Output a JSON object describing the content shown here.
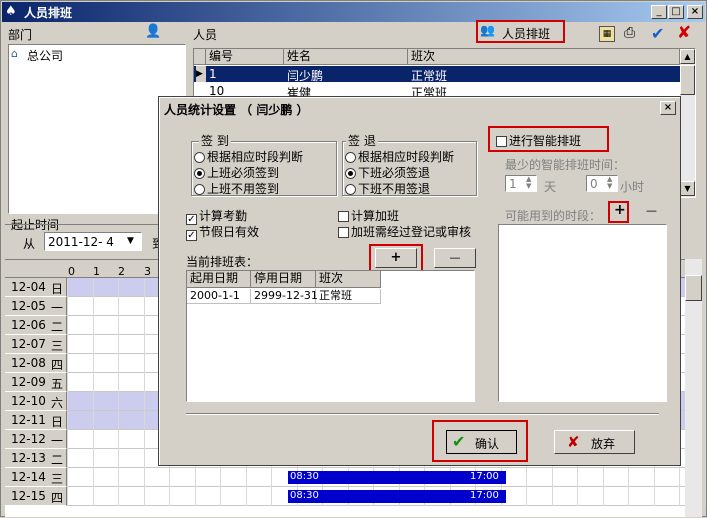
{
  "main_window": {
    "title": "人员排班",
    "dept_label": "部门",
    "person_label": "人员",
    "schedule_button": "人员排班",
    "tree_root": "总公司",
    "person_table": {
      "headers": [
        "编号",
        "姓名",
        "班次"
      ],
      "rows": [
        {
          "id": "1",
          "name": "闫少鹏",
          "shift": "正常班",
          "selected": true
        },
        {
          "id": "10",
          "name": "崔健",
          "shift": "正常班",
          "selected": false
        }
      ]
    },
    "period_label": "起止时间",
    "from_label": "从",
    "from_date": "2011-12- 4",
    "to_partial": "到",
    "hours": [
      "0",
      "1",
      "2",
      "3"
    ],
    "dates": [
      {
        "date": "12-04",
        "day": "日"
      },
      {
        "date": "12-05",
        "day": "一"
      },
      {
        "date": "12-06",
        "day": "二"
      },
      {
        "date": "12-07",
        "day": "三"
      },
      {
        "date": "12-08",
        "day": "四"
      },
      {
        "date": "12-09",
        "day": "五"
      },
      {
        "date": "12-10",
        "day": "六"
      },
      {
        "date": "12-11",
        "day": "日"
      },
      {
        "date": "12-12",
        "day": "一"
      },
      {
        "date": "12-13",
        "day": "二"
      },
      {
        "date": "12-14",
        "day": "三"
      },
      {
        "date": "12-15",
        "day": "四"
      }
    ],
    "shift_bars": [
      {
        "start": "08:30",
        "end": "17:00"
      },
      {
        "start": "08:30",
        "end": "17:00"
      }
    ]
  },
  "dialog": {
    "title": "人员统计设置 （ 闫少鹏 ）",
    "signin_group": "签 到",
    "signin_options": [
      "根据相应时段判断",
      "上班必须签到",
      "上班不用签到"
    ],
    "signin_selected": 1,
    "signout_group": "签 退",
    "signout_options": [
      "根据相应时段判断",
      "下班必须签退",
      "下班不用签退"
    ],
    "signout_selected": 1,
    "check_attendance": {
      "label": "计算考勤",
      "checked": true
    },
    "check_holiday": {
      "label": "节假日有效",
      "checked": true
    },
    "check_overtime": {
      "label": "计算加班",
      "checked": false
    },
    "check_overtime_audit": {
      "label": "加班需经过登记或审核",
      "checked": false
    },
    "smart_schedule": {
      "label": "进行智能排班",
      "checked": false
    },
    "min_time_label": "最少的智能排班时间：",
    "days_value": "1",
    "days_unit": "天",
    "hours_value": "0",
    "hours_unit": "小时",
    "periods_label": "可能用到的时段：",
    "current_table_label": "当前排班表：",
    "plus": "+",
    "minus": "—",
    "table_headers": [
      "起用日期",
      "停用日期",
      "班次"
    ],
    "table_rows": [
      {
        "start": "2000-1-1",
        "end": "2999-12-31",
        "shift": "正常班"
      }
    ],
    "ok_label": "确认",
    "cancel_label": "放弃"
  },
  "colors": {
    "titlebar": "#0a246a",
    "selected_row": "#0a246a",
    "highlight": "#d00000",
    "weekend_row": "#ccccee",
    "shift_bar": "#0000cc"
  }
}
